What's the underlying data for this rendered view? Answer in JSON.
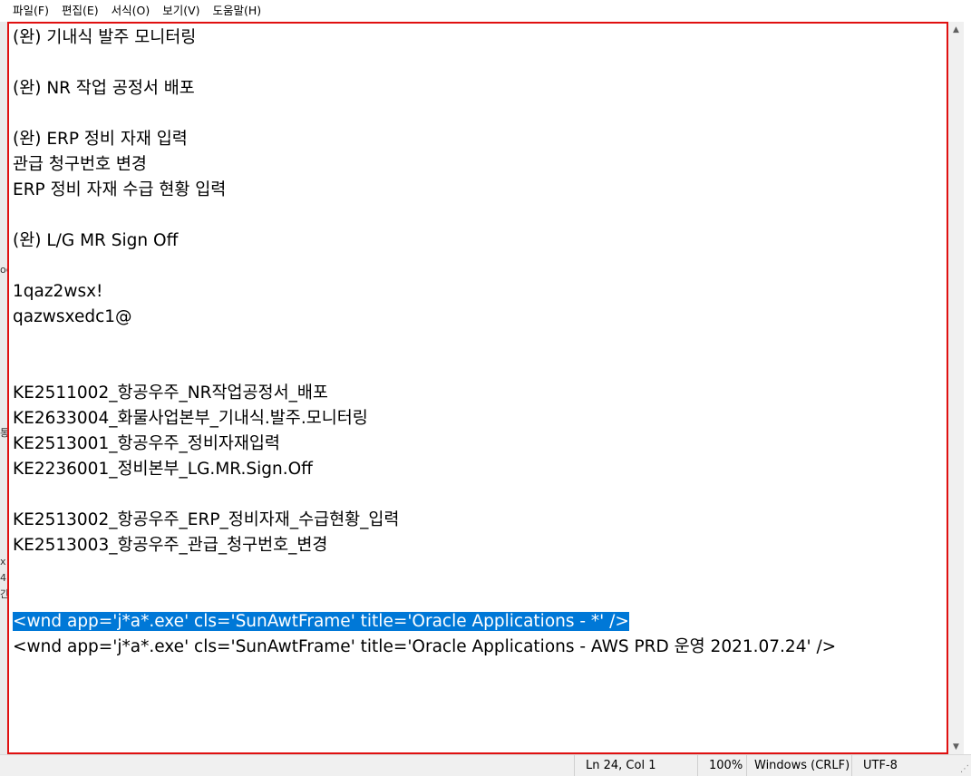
{
  "menu": {
    "file": "파일(F)",
    "edit": "편집(E)",
    "format": "서식(O)",
    "view": "보기(V)",
    "help": "도움말(H)"
  },
  "document": {
    "lines": [
      "(완) 기내식 발주 모니터링",
      "",
      "(완) NR 작업 공정서 배포",
      "",
      "(완) ERP 정비 자재 입력",
      "관급 청구번호 변경",
      "ERP 정비 자재 수급 현황 입력",
      "",
      "(완) L/G MR Sign Off",
      "",
      "1qaz2wsx!",
      "qazwsxedc1@",
      "",
      "",
      "KE2511002_항공우주_NR작업공정서_배포",
      "KE2633004_화물사업본부_기내식.발주.모니터링",
      "KE2513001_항공우주_정비자재입력",
      "KE2236001_정비본부_LG.MR.Sign.Off",
      "",
      "KE2513002_항공우주_ERP_정비자재_수급현황_입력",
      "KE2513003_항공우주_관급_청구번호_변경",
      "",
      "",
      "<wnd app='j*a*.exe' cls='SunAwtFrame' title='Oracle Applications - *' />",
      "<wnd app='j*a*.exe' cls='SunAwtFrame' title='Oracle Applications - AWS PRD 운영 2021.07.24' />"
    ],
    "selected_line": 23
  },
  "left_fragments": [
    "oc",
    "통",
    "x",
    "4",
    "간"
  ],
  "status": {
    "position": "Ln 24, Col 1",
    "zoom": "100%",
    "line_ending": "Windows (CRLF)",
    "encoding": "UTF-8"
  },
  "colors": {
    "selection": "#0078d7",
    "highlight_border": "#e01010"
  }
}
